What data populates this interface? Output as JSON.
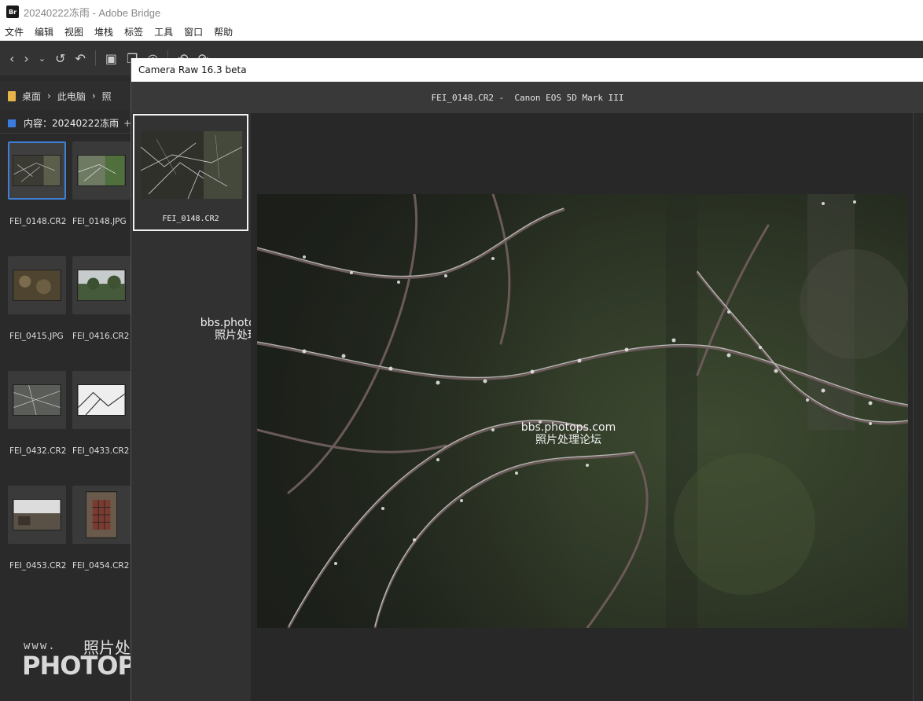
{
  "bridge": {
    "title": "20240222冻雨 - Adobe Bridge",
    "logo": "Br",
    "menu": [
      "文件",
      "编辑",
      "视图",
      "堆栈",
      "标签",
      "工具",
      "窗口",
      "帮助"
    ],
    "path": [
      "桌面",
      "此电脑",
      "照"
    ],
    "content_header": "内容：20240222冻雨",
    "plus": "+",
    "thumbnails": [
      {
        "name": "FEI_0148.CR2",
        "selected": true
      },
      {
        "name": "FEI_0148.JPG"
      },
      {
        "name": "FEI_0415.JPG"
      },
      {
        "name": "FEI_0416.CR2"
      },
      {
        "name": "FEI_0432.CR2"
      },
      {
        "name": "FEI_0433.CR2"
      },
      {
        "name": "FEI_0453.CR2"
      },
      {
        "name": "FEI_0454.CR2"
      }
    ]
  },
  "camera_raw": {
    "title": "Camera Raw 16.3 beta",
    "header": "FEI_0148.CR2 -  Canon EOS 5D Mark III",
    "filmstrip_label": "FEI_0148.CR2"
  },
  "watermarks": {
    "www": "www.",
    "site_cn": "照片处理网",
    "site_com": "PHOTOPS.COM",
    "overlay_url": "bbs.photops.com",
    "overlay_cn": "照片处理论坛"
  },
  "colors": {
    "accent": "#3f7fd6",
    "folder": "#e8b34b"
  }
}
